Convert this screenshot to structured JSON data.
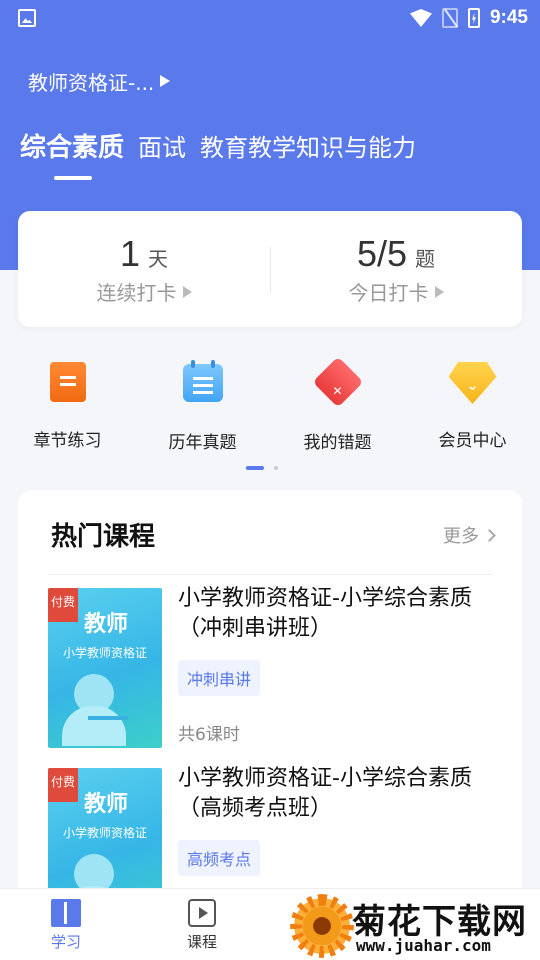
{
  "status_bar": {
    "time": "9:45",
    "icons": [
      "image-icon",
      "wifi-icon",
      "no-sim-icon",
      "battery-charging-icon"
    ]
  },
  "header": {
    "cert_selector": "教师资格证-...",
    "tabs": [
      {
        "label": "综合素质",
        "active": true
      },
      {
        "label": "面试",
        "active": false
      },
      {
        "label": "教育教学知识与能力",
        "active": false
      }
    ]
  },
  "checkin": {
    "streak": {
      "value": "1",
      "unit": "天",
      "label": "连续打卡"
    },
    "today": {
      "value": "5/5",
      "unit": "题",
      "label": "今日打卡"
    }
  },
  "quick_actions": [
    {
      "label": "章节练习",
      "icon": "chapter-practice-icon"
    },
    {
      "label": "历年真题",
      "icon": "past-exams-icon"
    },
    {
      "label": "我的错题",
      "icon": "wrong-questions-icon"
    },
    {
      "label": "会员中心",
      "icon": "vip-diamond-icon"
    }
  ],
  "pager": {
    "pages": 2,
    "current": 1
  },
  "courses": {
    "title": "热门课程",
    "more": "更多",
    "items": [
      {
        "badge": "付费",
        "thumb_title": "教师",
        "thumb_sub": "小学教师资格证",
        "title": "小学教师资格证-小学综合素质（冲刺串讲班）",
        "tag": "冲刺串讲",
        "lessons": "共6课时"
      },
      {
        "badge": "付费",
        "thumb_title": "教师",
        "thumb_sub": "小学教师资格证",
        "title": "小学教师资格证-小学综合素质（高频考点班）",
        "tag": "高频考点",
        "lessons": ""
      }
    ]
  },
  "bottom_nav": [
    {
      "label": "学习",
      "icon": "book-icon",
      "active": true
    },
    {
      "label": "课程",
      "icon": "play-icon",
      "active": false
    }
  ],
  "watermark": {
    "title": "菊花下载网",
    "url": "www.juahar.com"
  },
  "colors": {
    "primary": "#5a79ea",
    "background": "#f5f6fa",
    "paid_badge": "#e04a3a"
  }
}
